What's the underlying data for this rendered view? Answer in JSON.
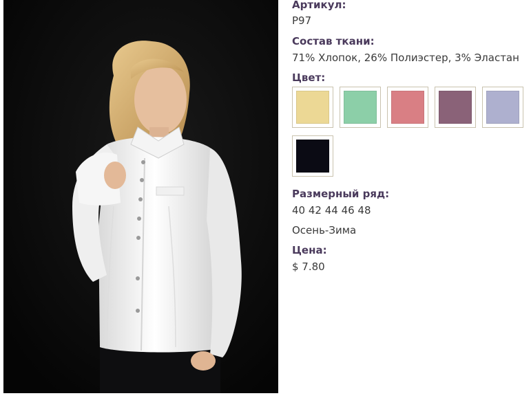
{
  "product": {
    "photo_alt": "",
    "sku_label": "Артикул:",
    "sku_value": "P97",
    "fabric_label": "Состав ткани:",
    "fabric_value": "71% Хлопок, 26% Полиэстер, 3% Эластан",
    "color_label": "Цвет:",
    "colors": [
      {
        "name": "yellow",
        "hex": "#ecd895"
      },
      {
        "name": "mint",
        "hex": "#8ccfa8"
      },
      {
        "name": "pink",
        "hex": "#d97f84"
      },
      {
        "name": "plum",
        "hex": "#8a6278"
      },
      {
        "name": "lavender",
        "hex": "#aeb0cf"
      },
      {
        "name": "black",
        "hex": "#0b0b14"
      }
    ],
    "size_label": "Размерный ряд:",
    "size_value": "40 42 44 46 48",
    "season_value": "Осень-Зима",
    "price_label": "Цена:",
    "price_value": "$ 7.80"
  }
}
